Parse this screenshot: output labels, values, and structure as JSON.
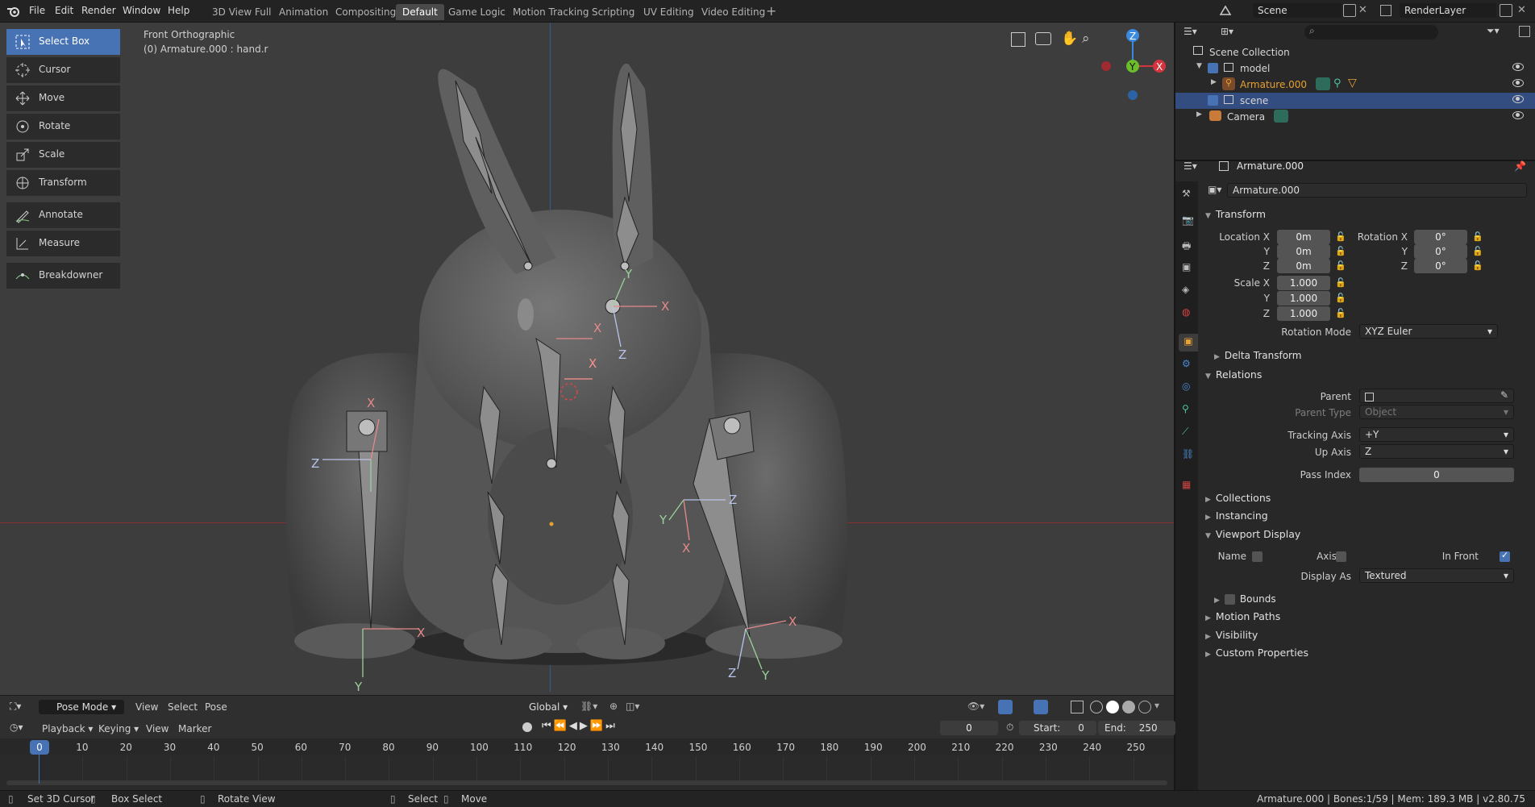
{
  "menu": {
    "items": [
      "File",
      "Edit",
      "Render",
      "Window",
      "Help"
    ]
  },
  "workspaces": [
    "3D View Full",
    "Animation",
    "Compositing",
    "Default",
    "Game Logic",
    "Motion Tracking",
    "Scripting",
    "UV Editing",
    "Video Editing"
  ],
  "active_workspace": "Default",
  "scene_name": "Scene",
  "view_layer": "RenderLayer",
  "viewport": {
    "view_name": "Front Orthographic",
    "object_info": "(0) Armature.000 : hand.r"
  },
  "tools": [
    "Select Box",
    "Cursor",
    "Move",
    "Rotate",
    "Scale",
    "Transform",
    "Annotate",
    "Measure",
    "Breakdowner"
  ],
  "active_tool": "Select Box",
  "header3d": {
    "mode": "Pose Mode",
    "menus": [
      "View",
      "Select",
      "Pose"
    ],
    "orientation": "Global"
  },
  "outliner": {
    "root": "Scene Collection",
    "rows": [
      {
        "name": "model",
        "level": 1
      },
      {
        "name": "Armature.000",
        "level": 2,
        "highlight": true
      },
      {
        "name": "scene",
        "level": 1,
        "selected": true
      },
      {
        "name": "Camera",
        "level": 1
      }
    ]
  },
  "properties": {
    "object_name": "Armature.000",
    "data_name": "Armature.000",
    "transform_title": "Transform",
    "location_label": "Location X",
    "location": [
      "0m",
      "0m",
      "0m"
    ],
    "rotation_label": "Rotation X",
    "rotation": [
      "0°",
      "0°",
      "0°"
    ],
    "scale_label": "Scale X",
    "scale": [
      "1.000",
      "1.000",
      "1.000"
    ],
    "axis_y": "Y",
    "axis_z": "Z",
    "rotation_mode_label": "Rotation Mode",
    "rotation_mode": "XYZ Euler",
    "delta": "Delta Transform",
    "relations": "Relations",
    "parent_label": "Parent",
    "parent_type_label": "Parent Type",
    "parent_type": "Object",
    "tracking_axis_label": "Tracking Axis",
    "tracking_axis": "+Y",
    "up_axis_label": "Up Axis",
    "up_axis": "Z",
    "pass_index_label": "Pass Index",
    "pass_index": "0",
    "collections": "Collections",
    "instancing": "Instancing",
    "viewport_display": "Viewport Display",
    "name_label": "Name",
    "axis_label": "Axis",
    "in_front_label": "In Front",
    "display_as_label": "Display As",
    "display_as": "Textured",
    "bounds": "Bounds",
    "motion_paths": "Motion Paths",
    "visibility": "Visibility",
    "custom_properties": "Custom Properties"
  },
  "timeline": {
    "menus": [
      "Playback",
      "Keying",
      "View",
      "Marker"
    ],
    "current_frame": "0",
    "start_label": "Start:",
    "start": "0",
    "end_label": "End:",
    "end": "250",
    "ticks": [
      "0",
      "10",
      "20",
      "30",
      "40",
      "50",
      "60",
      "70",
      "80",
      "90",
      "100",
      "110",
      "120",
      "130",
      "140",
      "150",
      "160",
      "170",
      "180",
      "190",
      "200",
      "210",
      "220",
      "230",
      "240",
      "250"
    ]
  },
  "statusbar": {
    "left": [
      "Set 3D Cursor",
      "Box Select",
      "Rotate View",
      "Select",
      "Move"
    ],
    "right": "Armature.000 | Bones:1/59 | Mem: 189.3 MB | v2.80.75"
  },
  "colors": {
    "accent": "#4772b3",
    "x_axis": "#d4343d",
    "y_axis": "#6cbc2c",
    "z_axis": "#3a8ae0",
    "armature_orange": "#e8a030"
  }
}
